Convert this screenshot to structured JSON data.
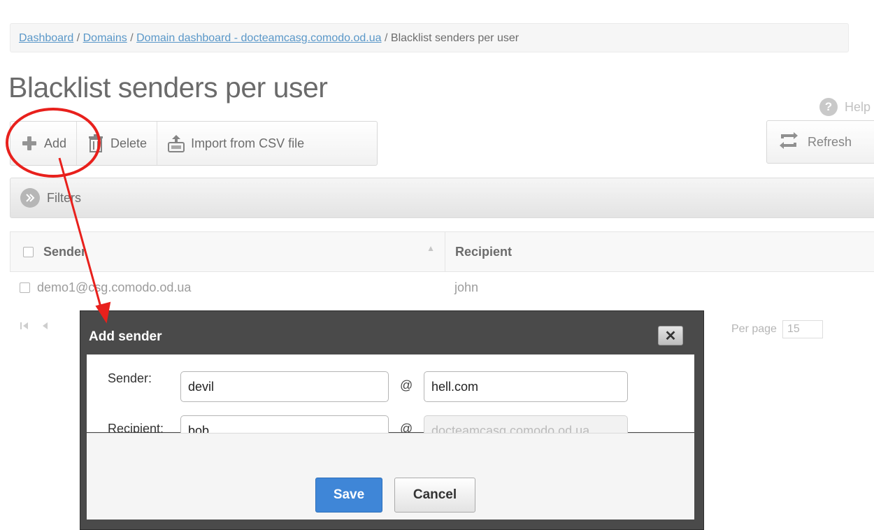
{
  "breadcrumb": {
    "items": [
      "Dashboard",
      "Domains",
      "Domain dashboard - docteamcasg.comodo.od.ua"
    ],
    "separator": " / ",
    "current": "Blacklist senders per user"
  },
  "page": {
    "title": "Blacklist senders per user",
    "help_label": "Help"
  },
  "toolbar": {
    "add_label": "Add",
    "delete_label": "Delete",
    "import_label": "Import from CSV file",
    "refresh_label": "Refresh"
  },
  "filters": {
    "label": "Filters"
  },
  "grid": {
    "columns": [
      "Sender",
      "Recipient"
    ],
    "rows": [
      {
        "sender": "demo1@csg.comodo.od.ua",
        "recipient": "john"
      }
    ]
  },
  "pager": {
    "per_page_label": "Per page",
    "per_page_value": "15"
  },
  "dialog": {
    "title": "Add sender",
    "close_glyph": "✕",
    "sender_label": "Sender:",
    "sender_user": "devil",
    "sender_domain": "hell.com",
    "recipient_label": "Recipient:",
    "recipient_user": "bob",
    "recipient_domain": "docteamcasg.comodo.od.ua",
    "at_symbol": "@",
    "save_label": "Save",
    "cancel_label": "Cancel"
  },
  "icons": {
    "add": "plus-icon",
    "delete": "trash-icon",
    "import": "csv-upload-icon",
    "refresh": "refresh-icon",
    "filters": "chevron-right-circle-icon",
    "help": "question-circle-icon"
  },
  "colors": {
    "link": "#1a6fb3",
    "primary_button": "#3f86d7",
    "dialog_frame": "#4a4a4a",
    "annotation": "#e8201c"
  }
}
